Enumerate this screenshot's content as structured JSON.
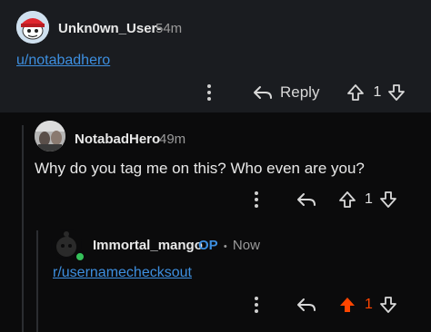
{
  "comments": [
    {
      "username": "Unkn0wn_User-",
      "time": "54m",
      "link_text": "u/notabadhero",
      "reply_label": "Reply",
      "score": "1"
    },
    {
      "username": "NotabadHero",
      "time": "49m",
      "text": "Why do you tag me on this? Who even are you?",
      "score": "1"
    },
    {
      "username": "Immortal_mango",
      "op_badge": "OP",
      "separator": "•",
      "time": "Now",
      "link_text": "r/usernamechecksout",
      "score": "1",
      "upvoted": true
    }
  ],
  "colors": {
    "upvote_active": "#ff4500",
    "link": "#3d8fe0",
    "online": "#35c15a"
  },
  "icons": [
    "more-options-icon",
    "reply-arrow-icon",
    "upvote-arrow-icon",
    "downvote-arrow-icon"
  ]
}
